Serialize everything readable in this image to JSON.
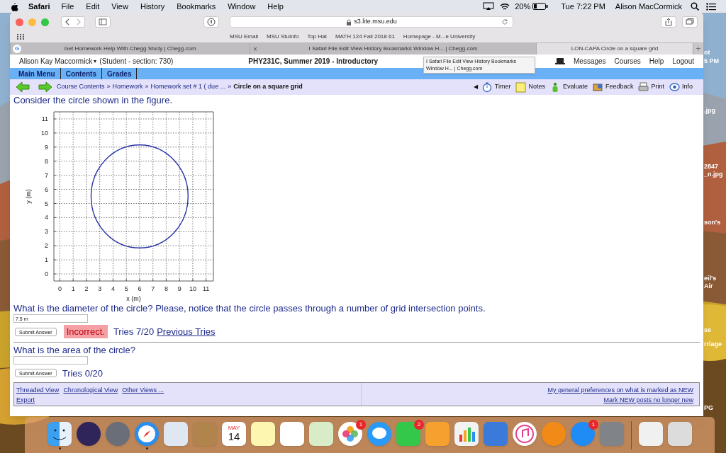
{
  "menu_bar": {
    "app": "Safari",
    "menus": [
      "File",
      "Edit",
      "View",
      "History",
      "Bookmarks",
      "Window",
      "Help"
    ],
    "battery": "20%",
    "clock": "Tue 7:22 PM",
    "user": "Alison MacCormick"
  },
  "browser": {
    "address": "s3.lite.msu.edu",
    "bookmarks": [
      "MSU Email",
      "MSU StuInfo",
      "Top Hat",
      "MATH 124 Fall 2018 61",
      "Homepage - M...e University"
    ],
    "tabs": [
      {
        "title": "Get Homework Help With Chegg Study | Chegg.com",
        "selected": false,
        "favicon": "G"
      },
      {
        "title": "I Safari File Edit View History Bookmarks Window H... | Chegg.com",
        "selected": false,
        "close": "×"
      },
      {
        "title": "LON-CAPA Circle on a square grid",
        "selected": true
      }
    ],
    "new_tab": "+"
  },
  "page": {
    "user": "Alison Kay Maccormick",
    "user_caret": "▾",
    "role": "(Student  - section: 730)",
    "course": "PHY231C, Summer 2019 - Introductory",
    "tooltip": "I Safari File Edit View History Bookmarks Window H... | Chegg.com",
    "links": [
      "Messages",
      "Courses",
      "Help",
      "Logout"
    ],
    "nav": [
      "Main Menu",
      "Contents",
      "Grades"
    ],
    "separator": "»",
    "breadcrumb": [
      {
        "label": "Course Contents",
        "current": false
      },
      {
        "label": "Homework",
        "current": false
      },
      {
        "label": "Homework set # 1 ( due ...",
        "current": false
      },
      {
        "label": "Circle on a square grid",
        "current": true
      }
    ],
    "tools_toggle": "◀",
    "tools": [
      {
        "label": "Timer",
        "kind": "timer"
      },
      {
        "label": "Notes",
        "kind": "notes"
      },
      {
        "label": "Evaluate",
        "kind": "evaluate"
      },
      {
        "label": "Feedback",
        "kind": "feedback"
      },
      {
        "label": "Print",
        "kind": "print"
      },
      {
        "label": "Info",
        "kind": "info"
      }
    ],
    "intro": "Consider the circle shown in the figure.",
    "chart_data": {
      "type": "line",
      "xlabel": "x (m)",
      "ylabel": "y (m)",
      "grid": true,
      "xlim": [
        -0.45,
        11.55
      ],
      "ylim": [
        -0.5,
        11.5
      ],
      "xticks": [
        0,
        1,
        2,
        3,
        4,
        5,
        6,
        7,
        8,
        9,
        10,
        11
      ],
      "yticks": [
        0,
        1,
        2,
        3,
        4,
        5,
        6,
        7,
        8,
        9,
        10,
        11
      ]
    },
    "questions": [
      {
        "prompt": "What is the diameter of the circle? Please, notice that the circle passes through a number of grid intersection points.",
        "answer": "7.5 m",
        "button": "Submit Answer",
        "result": "Incorrect.",
        "tries": "Tries 7/20",
        "link": "Previous Tries"
      },
      {
        "prompt": "What is the area of the circle?",
        "button": "Submit Answer",
        "tries": "Tries 0/20"
      }
    ],
    "footer": {
      "left": [
        "Threaded View",
        "Chronological View",
        "Other Views ..."
      ],
      "export": "Export",
      "right": [
        "My general preferences on what is marked as NEW",
        "Mark NEW posts no longer new"
      ]
    }
  },
  "desktop_labels": [
    "ot",
    "5 PM",
    ".jpg",
    "2847",
    "_n.jpg",
    "son's",
    "eil's",
    "Air",
    "se",
    "rriage",
    "PG"
  ],
  "dock": [
    {
      "kind": "finder",
      "running": true
    },
    {
      "kind": "siri",
      "running": false
    },
    {
      "kind": "launchpad",
      "running": false
    },
    {
      "kind": "safari",
      "running": true
    },
    {
      "kind": "mail",
      "running": false
    },
    {
      "kind": "contacts",
      "running": false
    },
    {
      "kind": "calendar",
      "running": false,
      "month": "MAY",
      "day": "14"
    },
    {
      "kind": "notes",
      "running": false
    },
    {
      "kind": "reminders",
      "running": false
    },
    {
      "kind": "maps",
      "running": false
    },
    {
      "kind": "photos",
      "running": false,
      "badge": "1"
    },
    {
      "kind": "messages",
      "running": false
    },
    {
      "kind": "facetime",
      "running": false,
      "badge": "2"
    },
    {
      "kind": "pages",
      "running": false
    },
    {
      "kind": "numbers",
      "running": false
    },
    {
      "kind": "keynote",
      "running": false
    },
    {
      "kind": "music",
      "running": false
    },
    {
      "kind": "books",
      "running": false
    },
    {
      "kind": "appstore",
      "running": false,
      "badge": "1"
    },
    {
      "kind": "preferences",
      "running": false
    },
    {
      "kind": "separator"
    },
    {
      "kind": "document",
      "running": false
    },
    {
      "kind": "trash",
      "running": false
    }
  ]
}
